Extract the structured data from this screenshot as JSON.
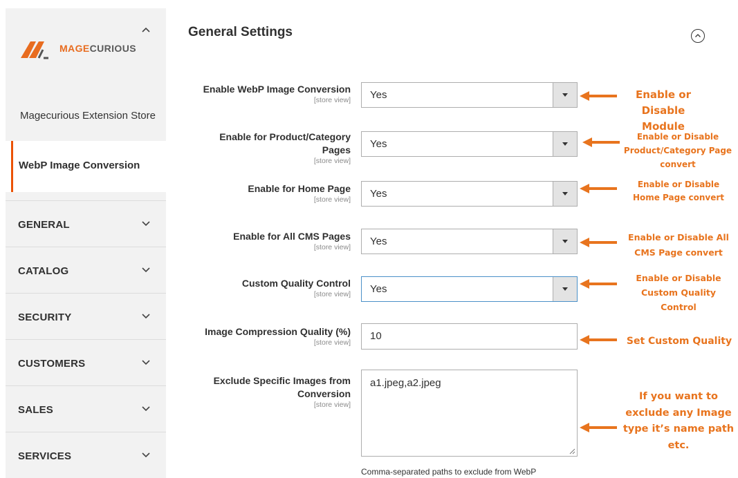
{
  "sidebar": {
    "brand": {
      "text_part1": "MAGE",
      "text_part2": "CURIOUS",
      "logo_icon": "magecurious-logo-icon",
      "collapse_icon": "chevron-up-icon"
    },
    "store_item": "Magecurious Extension Store",
    "active_item": "WebP Image Conversion",
    "sections": [
      "GENERAL",
      "CATALOG",
      "SECURITY",
      "CUSTOMERS",
      "SALES",
      "SERVICES"
    ],
    "section_icon": "chevron-down-icon"
  },
  "main": {
    "title": "General Settings",
    "collapse_icon": "circle-chevron-up-icon",
    "fields": [
      {
        "label": "Enable WebP Image Conversion",
        "scope": "[store view]",
        "value": "Yes"
      },
      {
        "label": "Enable for Product/Category Pages",
        "scope": "[store view]",
        "value": "Yes"
      },
      {
        "label": "Enable for Home Page",
        "scope": "[store view]",
        "value": "Yes"
      },
      {
        "label": "Enable for All CMS Pages",
        "scope": "[store view]",
        "value": "Yes"
      },
      {
        "label": "Custom Quality Control",
        "scope": "[store view]",
        "value": "Yes"
      },
      {
        "label": "Image Compression Quality (%)",
        "scope": "[store view]",
        "value": "10"
      },
      {
        "label": "Exclude Specific Images from Conversion",
        "scope": "[store view]",
        "value": "a1.jpeg,a2.jpeg"
      }
    ],
    "exclude_note": "Comma-separated paths to exclude from WebP"
  },
  "annotations": {
    "color": "#e8741e",
    "items": [
      "Enable or Disable Module",
      "Enable or Disable Product/Category Page convert",
      "Enable or Disable Home Page convert",
      "Enable or Disable All CMS Page convert",
      "Enable or Disable Custom Quality Control",
      "Set Custom Quality",
      "If you want to exclude any Image type it’s name path etc."
    ]
  },
  "colors": {
    "accent": "#eb5202",
    "sidebar_bg": "#f2f2f2",
    "focus_border": "#4a90c8"
  }
}
